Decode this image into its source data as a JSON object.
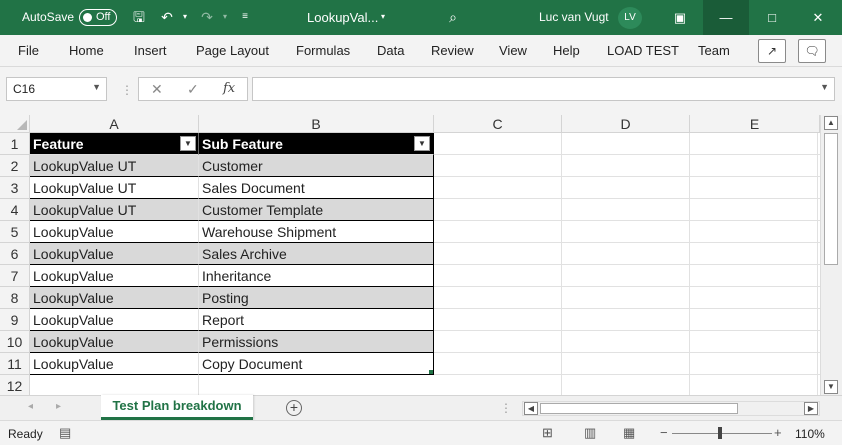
{
  "titlebar": {
    "autosave_label": "AutoSave",
    "autosave_state": "Off",
    "filename": "LookupVal...",
    "user_name": "Luc van Vugt",
    "user_initials": "LV"
  },
  "ribbon": {
    "tabs": [
      "File",
      "Home",
      "Insert",
      "Page Layout",
      "Formulas",
      "Data",
      "Review",
      "View",
      "Help",
      "LOAD TEST",
      "Team"
    ]
  },
  "formula_bar": {
    "name_box": "C16",
    "fx_label": "fx",
    "formula": ""
  },
  "grid": {
    "columns": [
      "A",
      "B",
      "C",
      "D",
      "E"
    ],
    "rows": [
      "1",
      "2",
      "3",
      "4",
      "5",
      "6",
      "7",
      "8",
      "9",
      "10",
      "11",
      "12"
    ],
    "table_headers": [
      "Feature",
      "Sub Feature"
    ],
    "table_rows": [
      [
        "LookupValue UT",
        "Customer"
      ],
      [
        "LookupValue UT",
        "Sales Document"
      ],
      [
        "LookupValue UT",
        "Customer Template"
      ],
      [
        "LookupValue",
        "Warehouse Shipment"
      ],
      [
        "LookupValue",
        "Sales Archive"
      ],
      [
        "LookupValue",
        "Inheritance"
      ],
      [
        "LookupValue",
        "Posting"
      ],
      [
        "LookupValue",
        "Report"
      ],
      [
        "LookupValue",
        "Permissions"
      ],
      [
        "LookupValue",
        "Copy Document"
      ]
    ]
  },
  "sheets": {
    "active": "Test Plan breakdown"
  },
  "status": {
    "ready": "Ready",
    "zoom": "110%"
  },
  "colors": {
    "excel_green": "#217346",
    "band_gray": "#d9d9d9",
    "header_black": "#000000"
  }
}
